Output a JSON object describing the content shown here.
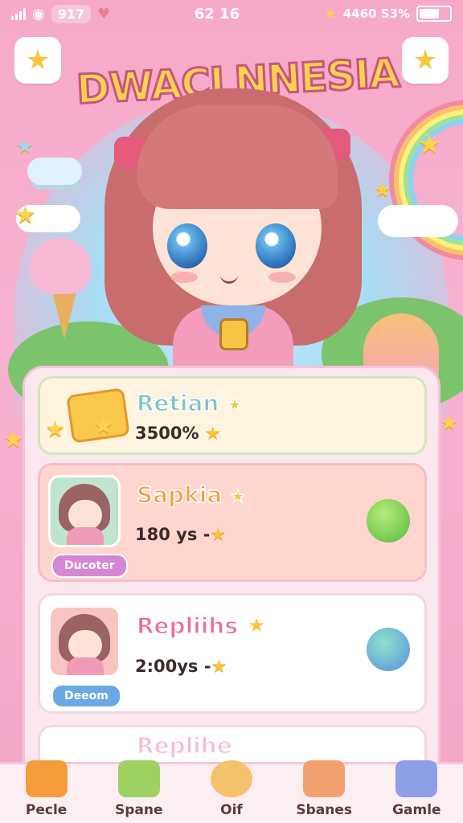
{
  "status_bar": {
    "left_text": "917",
    "time": "62 16",
    "right_text": "4460 S3%"
  },
  "title": "DWACLNNESIA",
  "cards": [
    {
      "name": "Retian",
      "sub": "3500%",
      "name_color": "#7cc4c9",
      "role": ""
    },
    {
      "name": "Sapkia",
      "sub": "180 ys -",
      "name_color": "#f2a24a",
      "role": "Ducoter",
      "role_color": "#d587d3"
    },
    {
      "name": "Repliihs",
      "sub": "2:00ys -",
      "name_color": "#ee6a9c",
      "role": "Deeom",
      "role_color": "#6aa8e6"
    },
    {
      "name": "Replihe",
      "sub": "",
      "name_color": "#f2a0c8",
      "role": ""
    }
  ],
  "nav": [
    {
      "label": "Pecle",
      "icon": "house-icon",
      "color": "#f59d3c"
    },
    {
      "label": "Spane",
      "icon": "microphone-icon",
      "color": "#9fd162"
    },
    {
      "label": "Oif",
      "icon": "cookie-icon",
      "color": "#f4c26a"
    },
    {
      "label": "Sbanes",
      "icon": "gift-box-icon",
      "color": "#f2a06e"
    },
    {
      "label": "Gamle",
      "icon": "game-cube-icon",
      "color": "#8e9fe8"
    }
  ]
}
